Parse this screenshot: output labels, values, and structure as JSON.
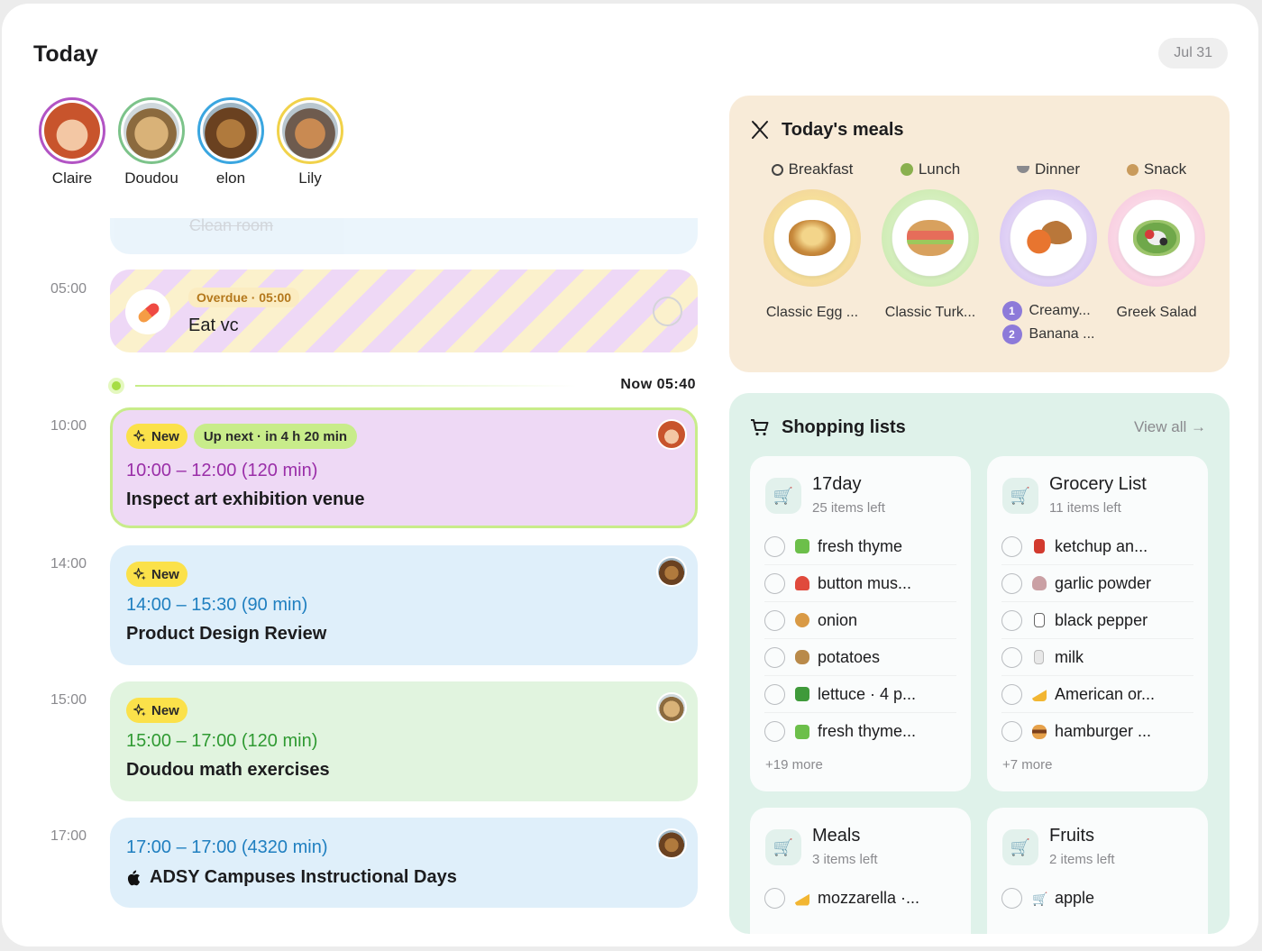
{
  "header": {
    "title": "Today",
    "date": "Jul 31"
  },
  "people": [
    {
      "name": "Claire",
      "ring": "#b254c4",
      "skin": "#f3c7a4",
      "hair": "#c8542c"
    },
    {
      "name": "Doudou",
      "ring": "#7cc38a",
      "skin": "#d9b278",
      "hair": "#8b6a3e"
    },
    {
      "name": "elon",
      "ring": "#3aa6e0",
      "skin": "#b07a3d",
      "hair": "#6a4120"
    },
    {
      "name": "Lily",
      "ring": "#f1d24a",
      "skin": "#c98a52",
      "hair": "#6e5b4e"
    }
  ],
  "timeline": {
    "faded_task": "Clean room",
    "times": [
      "05:00",
      "10:00",
      "14:00",
      "15:00",
      "17:00"
    ],
    "overdue": {
      "badge": "Overdue · 05:00",
      "title": "Eat vc"
    },
    "now_label": "Now 05:40",
    "events": [
      {
        "new_badge": "New",
        "up_next": "Up next · in 4 h 20 min",
        "time": "10:00 – 12:00 (120 min)",
        "title": "Inspect art exhibition venue",
        "time_color": "#9a2ea8"
      },
      {
        "new_badge": "New",
        "time": "14:00 – 15:30 (90 min)",
        "title": "Product Design Review",
        "time_color": "#1f7fc0"
      },
      {
        "new_badge": "New",
        "time": "15:00 – 17:00 (120 min)",
        "title": "Doudou math exercises",
        "time_color": "#2f9a32"
      },
      {
        "time": "17:00 – 17:00 (4320 min)",
        "title": "ADSY Campuses Instructional Days",
        "time_color": "#1f7fc0"
      }
    ]
  },
  "meals": {
    "title": "Today's meals",
    "columns": [
      {
        "type": "Breakfast",
        "icon": "magnifier-icon",
        "name": "Classic Egg ..."
      },
      {
        "type": "Lunch",
        "icon": "salad-icon",
        "name": "Classic Turk..."
      },
      {
        "type": "Dinner",
        "icon": "bowl-icon",
        "items": [
          "Creamy...",
          "Banana ..."
        ],
        "numbers": [
          "1",
          "2"
        ]
      },
      {
        "type": "Snack",
        "icon": "cookie-icon",
        "name": "Greek Salad"
      }
    ]
  },
  "shopping": {
    "title": "Shopping lists",
    "view_all": "View all →",
    "lists": [
      {
        "title": "17day",
        "sub": "25 items left",
        "items": [
          "fresh thyme",
          "button mus...",
          "onion",
          "potatoes",
          "lettuce · 4 p...",
          "fresh thyme..."
        ],
        "more": "+19 more"
      },
      {
        "title": "Grocery List",
        "sub": "11 items left",
        "items": [
          "ketchup an...",
          "garlic powder",
          "black pepper",
          "milk",
          "American or...",
          "hamburger ..."
        ],
        "more": "+7 more"
      },
      {
        "title": "Meals",
        "sub": "3 items left",
        "items": [
          "mozzarella ·..."
        ]
      },
      {
        "title": "Fruits",
        "sub": "2 items left",
        "items": [
          "apple"
        ]
      }
    ]
  }
}
